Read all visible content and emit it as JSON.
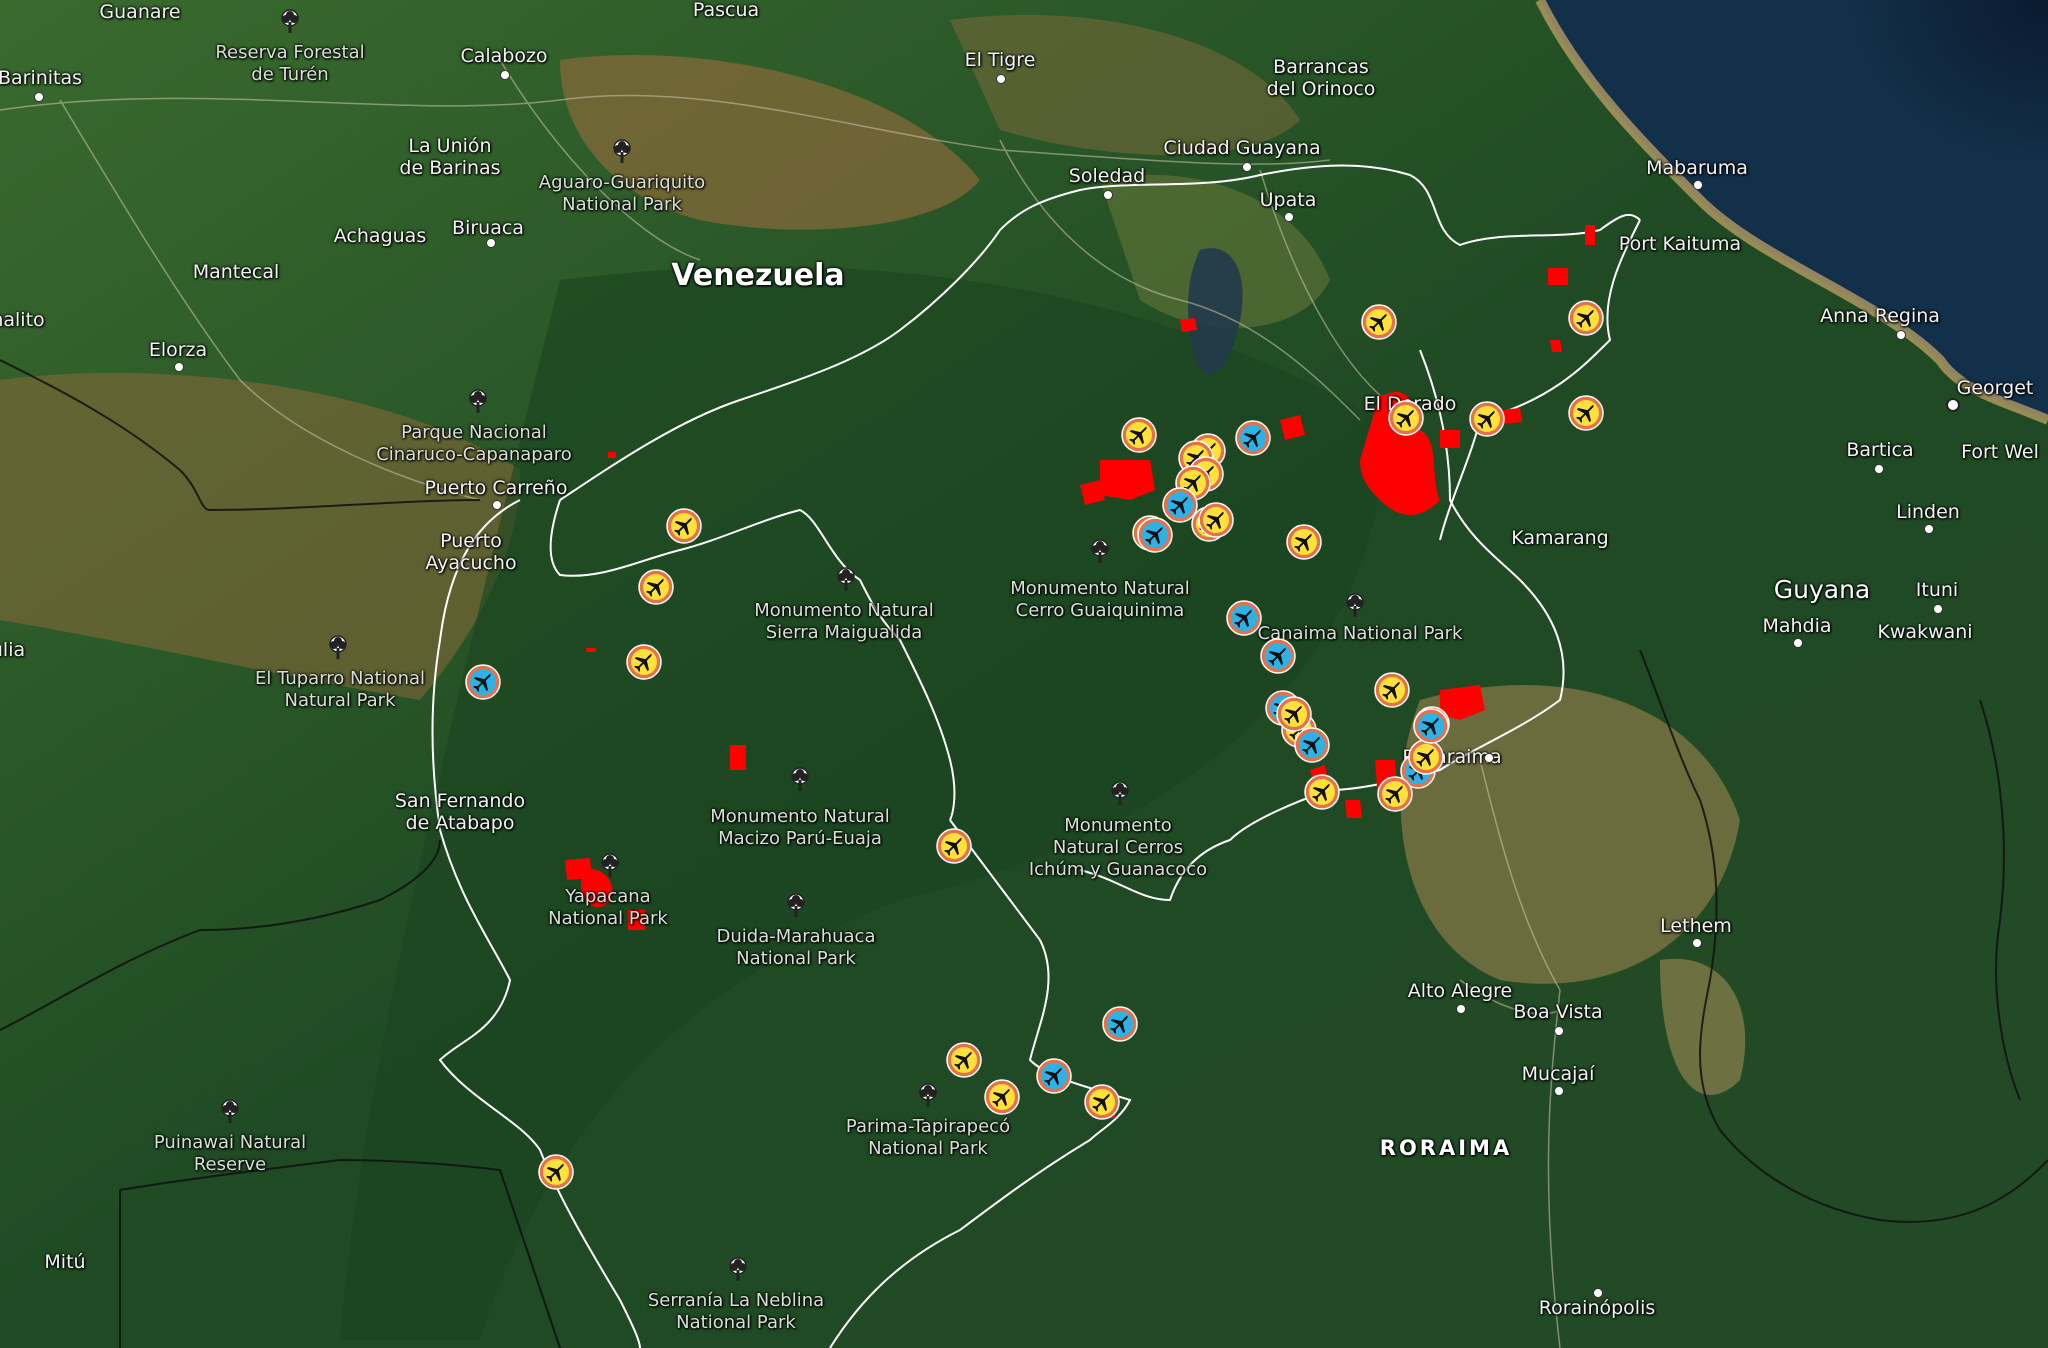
{
  "map": {
    "country_labels": [
      {
        "text": "Venezuela",
        "cls": "country"
      },
      {
        "text": "Guyana",
        "cls": "country-m"
      },
      {
        "text": "RORAIMA",
        "cls": "region"
      }
    ],
    "cities": [
      {
        "text": "Guanare"
      },
      {
        "text": "Barinitas"
      },
      {
        "text": "Pascua"
      },
      {
        "text": "Calabozo"
      },
      {
        "text": "El Tigre"
      },
      {
        "text": "Barrancas\ndel Orinoco"
      },
      {
        "text": "Ciudad Guayana"
      },
      {
        "text": "Soledad"
      },
      {
        "text": "Upata"
      },
      {
        "text": "Mabaruma"
      },
      {
        "text": "Port Kaituma"
      },
      {
        "text": "Anna Regina"
      },
      {
        "text": "Georget"
      },
      {
        "text": "La Unión\nde Barinas"
      },
      {
        "text": "Achaguas"
      },
      {
        "text": "Biruaca"
      },
      {
        "text": "Mantecal"
      },
      {
        "text": "nalito"
      },
      {
        "text": "Elorza"
      },
      {
        "text": "Puerto Carreño"
      },
      {
        "text": "Puerto\nAyacucho"
      },
      {
        "text": "ulia"
      },
      {
        "text": "San Fernando\nde Atabapo"
      },
      {
        "text": "El Dorado"
      },
      {
        "text": "Bartica"
      },
      {
        "text": "Fort Wel"
      },
      {
        "text": "Linden"
      },
      {
        "text": "Kamarang"
      },
      {
        "text": "Ituni"
      },
      {
        "text": "Mahdia"
      },
      {
        "text": "Kwakwani"
      },
      {
        "text": "Pacaraima"
      },
      {
        "text": "Lethem"
      },
      {
        "text": "Alto Alegre"
      },
      {
        "text": "Boa Vista"
      },
      {
        "text": "Mucajaí"
      },
      {
        "text": "Mitú"
      },
      {
        "text": "Rorainópolis"
      }
    ],
    "parks": [
      {
        "text": "Reserva Forestal\nde Turén"
      },
      {
        "text": "Aguaro-Guariquito\nNational Park"
      },
      {
        "text": "Parque Nacional\nCinaruco-Capanaparo"
      },
      {
        "text": "El Tuparro National\nNatural Park"
      },
      {
        "text": "Monumento Natural\nSierra Maigualida"
      },
      {
        "text": "Monumento Natural\nCerro Guaiquinima"
      },
      {
        "text": "Canaima National Park"
      },
      {
        "text": "Monumento Natural\nMacizo Parú-Euaja"
      },
      {
        "text": "Monumento\nNatural Cerros\nIchúm y Guanacoco"
      },
      {
        "text": "Yapacana\nNational Park"
      },
      {
        "text": "Duida-Marahuaca\nNational Park"
      },
      {
        "text": "Parima-Tapirapecó\nNational Park"
      },
      {
        "text": "Puinawai Natural\nReserve"
      },
      {
        "text": "Serranía La Neblina\nNational Park"
      }
    ],
    "markers": [
      {
        "type": "yellow"
      },
      {
        "type": "yellow"
      },
      {
        "type": "yellow"
      },
      {
        "type": "blue"
      },
      {
        "type": "yellow"
      },
      {
        "type": "yellow"
      },
      {
        "type": "blue"
      },
      {
        "type": "yellow"
      },
      {
        "type": "yellow"
      },
      {
        "type": "yellow"
      },
      {
        "type": "blue"
      },
      {
        "type": "yellow"
      },
      {
        "type": "yellow"
      },
      {
        "type": "yellow"
      },
      {
        "type": "yellow"
      },
      {
        "type": "blue"
      },
      {
        "type": "yellow"
      },
      {
        "type": "yellow"
      },
      {
        "type": "blue"
      },
      {
        "type": "blue"
      },
      {
        "type": "blue"
      },
      {
        "type": "yellow"
      },
      {
        "type": "blue"
      },
      {
        "type": "yellow"
      },
      {
        "type": "yellow"
      },
      {
        "type": "blue"
      },
      {
        "type": "yellow"
      },
      {
        "type": "blue"
      },
      {
        "type": "yellow"
      },
      {
        "type": "yellow"
      },
      {
        "type": "yellow"
      },
      {
        "type": "blue"
      },
      {
        "type": "yellow"
      },
      {
        "type": "blue"
      },
      {
        "type": "yellow"
      },
      {
        "type": "yellow"
      },
      {
        "type": "yellow"
      },
      {
        "type": "yellow"
      },
      {
        "type": "yellow"
      },
      {
        "type": "yellow"
      },
      {
        "type": "yellow"
      }
    ],
    "colors": {
      "marker_yellow": "#ffe13a",
      "marker_blue": "#2bb3e8",
      "marker_ring": "#e5704a",
      "mining_area": "#ff0000",
      "border": "#ffffff"
    },
    "icons": {
      "airstrip": "airplane-icon",
      "park": "tree-icon"
    }
  }
}
